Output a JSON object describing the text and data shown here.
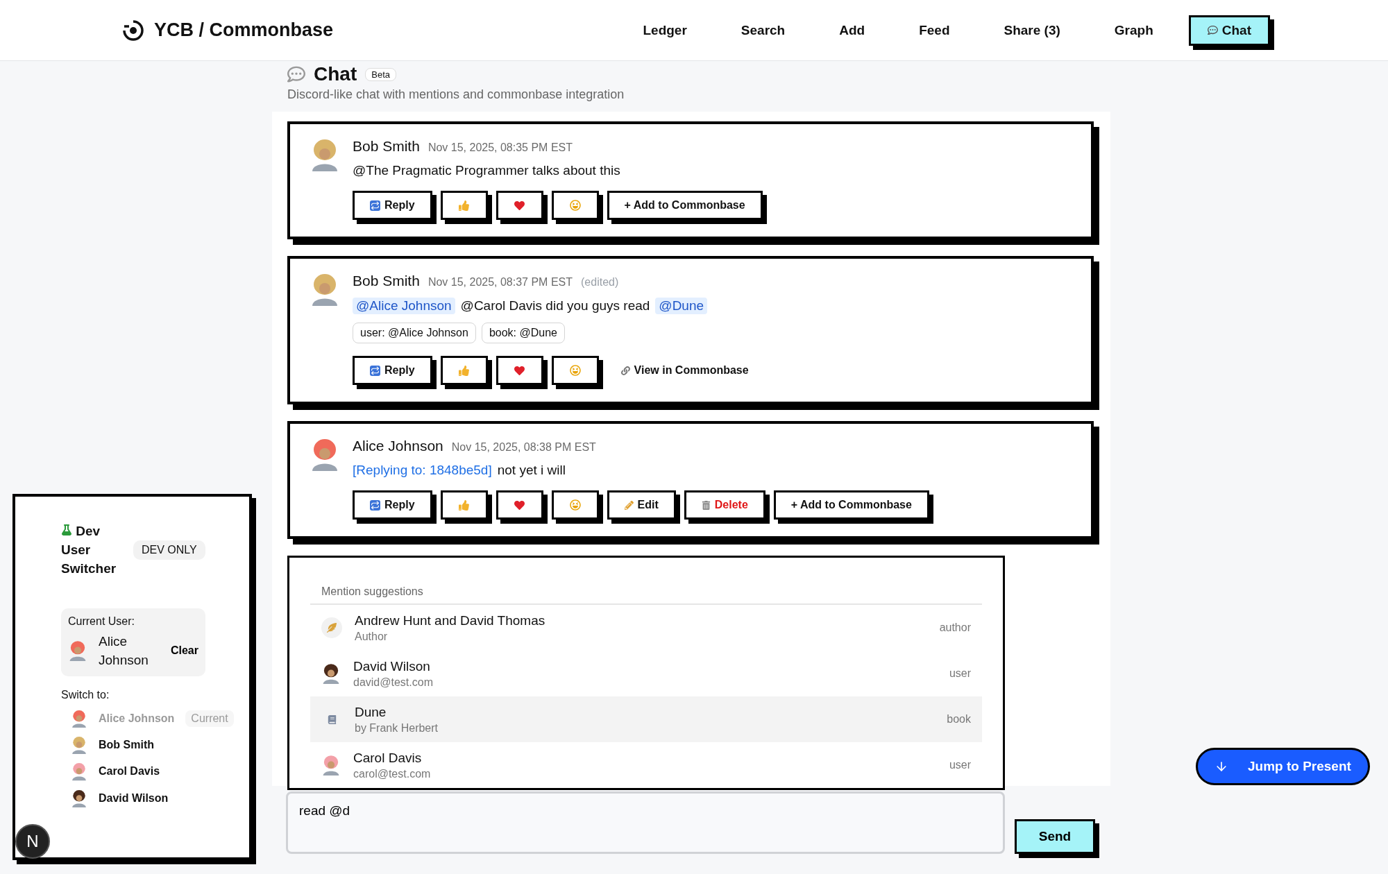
{
  "header": {
    "brand": "YCB / Commonbase",
    "nav": [
      {
        "label": "Ledger",
        "selected": false
      },
      {
        "label": "Search",
        "selected": false
      },
      {
        "label": "Add",
        "selected": false
      },
      {
        "label": "Feed",
        "selected": false
      },
      {
        "label": "Share (3)",
        "selected": false
      },
      {
        "label": "Graph",
        "selected": false
      },
      {
        "label": "Chat",
        "selected": true
      }
    ]
  },
  "page": {
    "title": "Chat",
    "badge": "Beta",
    "subtitle": "Discord-like chat with mentions and commonbase integration"
  },
  "messages": [
    {
      "author": "Bob Smith",
      "color": "#d9b46a",
      "time": "Nov 15, 2025, 08:35 PM EST",
      "body": [
        {
          "kind": "text",
          "text": "@The Pragmatic Programmer talks about this"
        }
      ],
      "actions": [
        {
          "kind": "reply",
          "label": "Reply"
        },
        {
          "kind": "thumbs"
        },
        {
          "kind": "heart"
        },
        {
          "kind": "laugh"
        },
        {
          "kind": "add",
          "label": "+ Add to Commonbase"
        }
      ]
    },
    {
      "author": "Bob Smith",
      "color": "#d9b46a",
      "time": "Nov 15, 2025, 08:37 PM EST",
      "edited": "(edited)",
      "body": [
        {
          "kind": "mention",
          "text": "@Alice Johnson"
        },
        {
          "kind": "text",
          "text": "@Carol Davis did you guys read"
        },
        {
          "kind": "mention",
          "text": "@Dune"
        }
      ],
      "chips": [
        "user: @Alice Johnson",
        "book: @Dune"
      ],
      "actions": [
        {
          "kind": "reply",
          "label": "Reply"
        },
        {
          "kind": "thumbs"
        },
        {
          "kind": "heart"
        },
        {
          "kind": "laugh"
        },
        {
          "kind": "link",
          "label": "View in Commonbase"
        }
      ]
    },
    {
      "author": "Alice Johnson",
      "color": "#f06a5a",
      "time": "Nov 15, 2025, 08:38 PM EST",
      "body": [
        {
          "kind": "reply_ref",
          "text": "[Replying to: 1848be5d]"
        },
        {
          "kind": "text",
          "text": "not yet i will"
        }
      ],
      "actions": [
        {
          "kind": "reply",
          "label": "Reply"
        },
        {
          "kind": "thumbs"
        },
        {
          "kind": "heart"
        },
        {
          "kind": "laugh"
        },
        {
          "kind": "edit",
          "label": "Edit"
        },
        {
          "kind": "delete",
          "label": "Delete"
        },
        {
          "kind": "add",
          "label": "+ Add to Commonbase"
        }
      ]
    }
  ],
  "suggestions": {
    "heading": "Mention suggestions",
    "items": [
      {
        "kind": "author",
        "name": "Andrew Hunt and David Thomas",
        "sub": "Author",
        "type": "author",
        "selected": false
      },
      {
        "kind": "user",
        "color": "#4a2a1a",
        "name": "David Wilson",
        "sub": "david@test.com",
        "type": "user",
        "selected": false
      },
      {
        "kind": "book",
        "name": "Dune",
        "sub": "by Frank Herbert",
        "type": "book",
        "selected": true
      },
      {
        "kind": "user",
        "color": "#f3a0a8",
        "name": "Carol Davis",
        "sub": "carol@test.com",
        "type": "user",
        "selected": false
      }
    ]
  },
  "composer": {
    "value": "read @d",
    "send": "Send"
  },
  "jump": "Jump to Present",
  "dev": {
    "title": "Dev User Switcher",
    "badge": "DEV ONLY",
    "current_label": "Current User:",
    "current_user": "Alice Johnson",
    "clear": "Clear",
    "switch_label": "Switch to:",
    "users": [
      {
        "name": "Alice Johnson",
        "color": "#f06a5a",
        "selected": true,
        "tag": "Current"
      },
      {
        "name": "Bob Smith",
        "color": "#d9b46a",
        "selected": false
      },
      {
        "name": "Carol Davis",
        "color": "#f3a0a8",
        "selected": false
      },
      {
        "name": "David Wilson",
        "color": "#4a2a1a",
        "selected": false
      }
    ]
  },
  "dev_badge": "N"
}
